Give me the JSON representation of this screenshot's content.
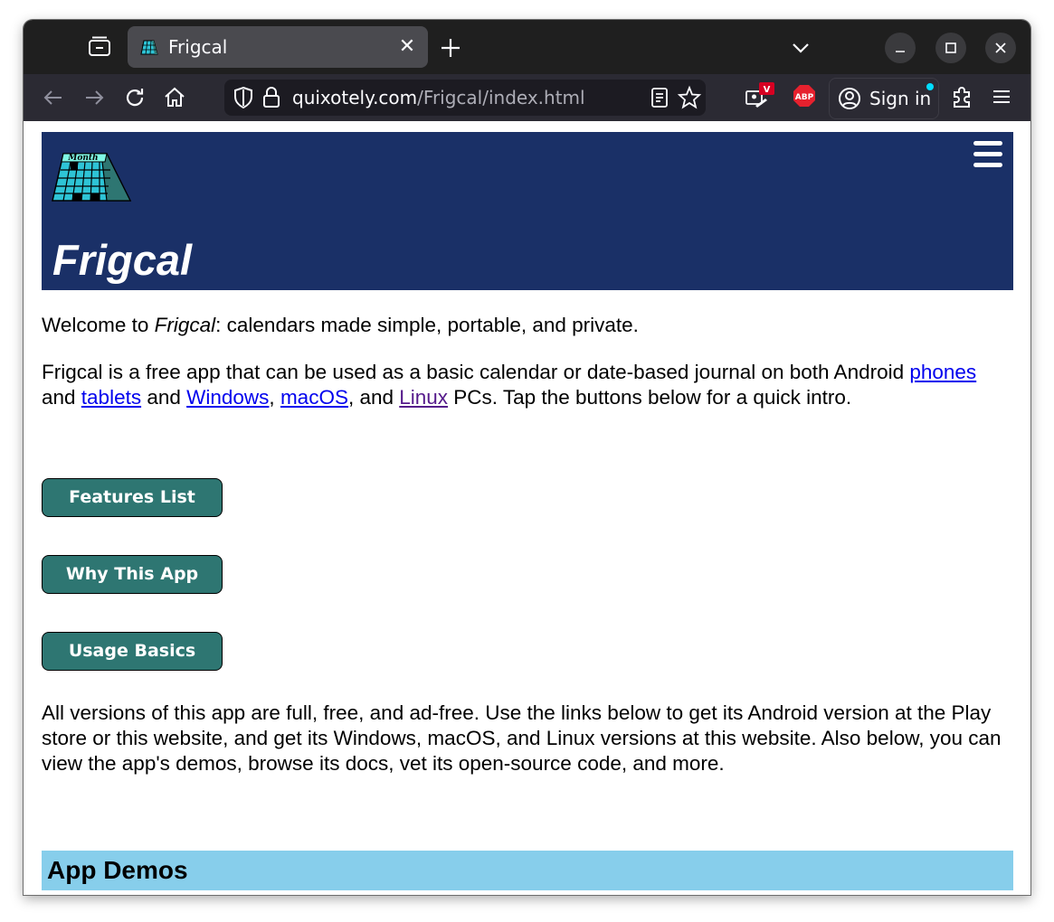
{
  "browser": {
    "tab": {
      "title": "Frigcal"
    },
    "url": {
      "domain": "quixotely.com",
      "path": "/Frigcal/index.html"
    },
    "sign_in_label": "Sign in",
    "vivaldi_badge": "V",
    "abp_label": "ABP"
  },
  "site": {
    "logo_text": "Month",
    "title": "Frigcal",
    "welcome": {
      "prefix": "Welcome to ",
      "app_name": "Frigcal",
      "suffix": ": calendars made simple, portable, and private."
    },
    "intro": {
      "t1": "Frigcal is a free app that can be used as a basic calendar or date-based journal on both Android ",
      "phones": "phones",
      "t2": " and ",
      "tablets": "tablets",
      "t3": " and ",
      "windows": "Windows",
      "t4": ", ",
      "macos": "macOS",
      "t5": ", and ",
      "linux": "Linux",
      "t6": " PCs. Tap the buttons below for a quick intro."
    },
    "buttons": [
      "Features List",
      "Why This App",
      "Usage Basics"
    ],
    "versions_text": "All versions of this app are full, free, and ad-free. Use the links below to get its Android version at the Play store or this website, and get its Windows, macOS, and Linux versions at this website. Also below, you can view the app's demos, browse its docs, vet its open-source code, and more.",
    "section_title": "App Demos"
  },
  "colors": {
    "header_bg": "#1a3067",
    "button_bg": "#2e7672",
    "section_bg": "#87ceeb",
    "link": "#0000ee",
    "visited_link": "#551a8b"
  }
}
